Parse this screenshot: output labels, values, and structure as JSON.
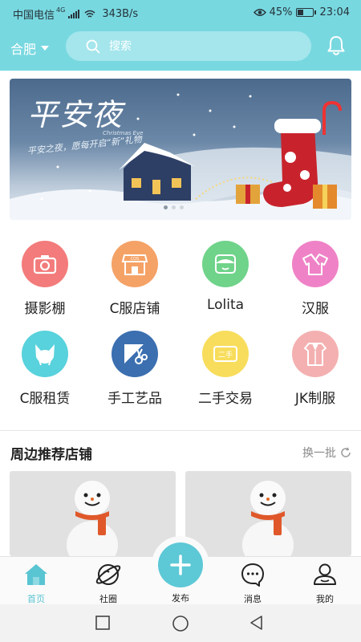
{
  "status_bar": {
    "carrier": "中国电信",
    "network": "4G",
    "speed": "343B/s",
    "battery": "45%",
    "battery_level": 0.45,
    "time": "23:04",
    "icons": [
      "signal-icon",
      "wifi-icon",
      "eye-icon",
      "battery-icon"
    ]
  },
  "header": {
    "city": "合肥",
    "search_placeholder": "搜索",
    "bell_icon": "bell-icon",
    "accent": "#78d8e0"
  },
  "banner": {
    "title": "平安夜",
    "subtitle": "平安之夜，愿每开启“新”礼物",
    "english": "Christmas Eve",
    "page_count": 3,
    "active_page": 1
  },
  "categories": [
    {
      "label": "摄影棚",
      "icon": "camera-icon",
      "color": "#f37b7b"
    },
    {
      "label": "C服店铺",
      "icon": "shop-icon",
      "color": "#f5a266"
    },
    {
      "label": "Lolita",
      "icon": "lolita-icon",
      "color": "#6fd38a"
    },
    {
      "label": "汉服",
      "icon": "hanfu-icon",
      "color": "#ef82c6"
    },
    {
      "label": "C服租赁",
      "icon": "cat-ears-icon",
      "color": "#58d2dc"
    },
    {
      "label": "手工艺品",
      "icon": "craft-scissors-icon",
      "color": "#3b6fb0"
    },
    {
      "label": "二手交易",
      "icon": "second-hand-icon",
      "color": "#f8dd5c"
    },
    {
      "label": "JK制服",
      "icon": "uniform-icon",
      "color": "#f4b0b0"
    }
  ],
  "recommended": {
    "title": "周边推荐店铺",
    "refresh_label": "换一批",
    "cards": [
      {
        "image": "snowman-image"
      },
      {
        "image": "snowman-image"
      }
    ]
  },
  "bottom_nav": {
    "items": [
      {
        "label": "首页",
        "icon": "home-icon",
        "active": true
      },
      {
        "label": "社圈",
        "icon": "planet-icon",
        "active": false
      },
      {
        "label": "发布",
        "icon": "plus-icon",
        "active": false
      },
      {
        "label": "消息",
        "icon": "message-icon",
        "active": false
      },
      {
        "label": "我的",
        "icon": "profile-icon",
        "active": false
      }
    ],
    "active_color": "#59c4d2"
  },
  "system_nav": {
    "icons": [
      "recent-apps-icon",
      "home-circle-icon",
      "back-icon"
    ]
  }
}
